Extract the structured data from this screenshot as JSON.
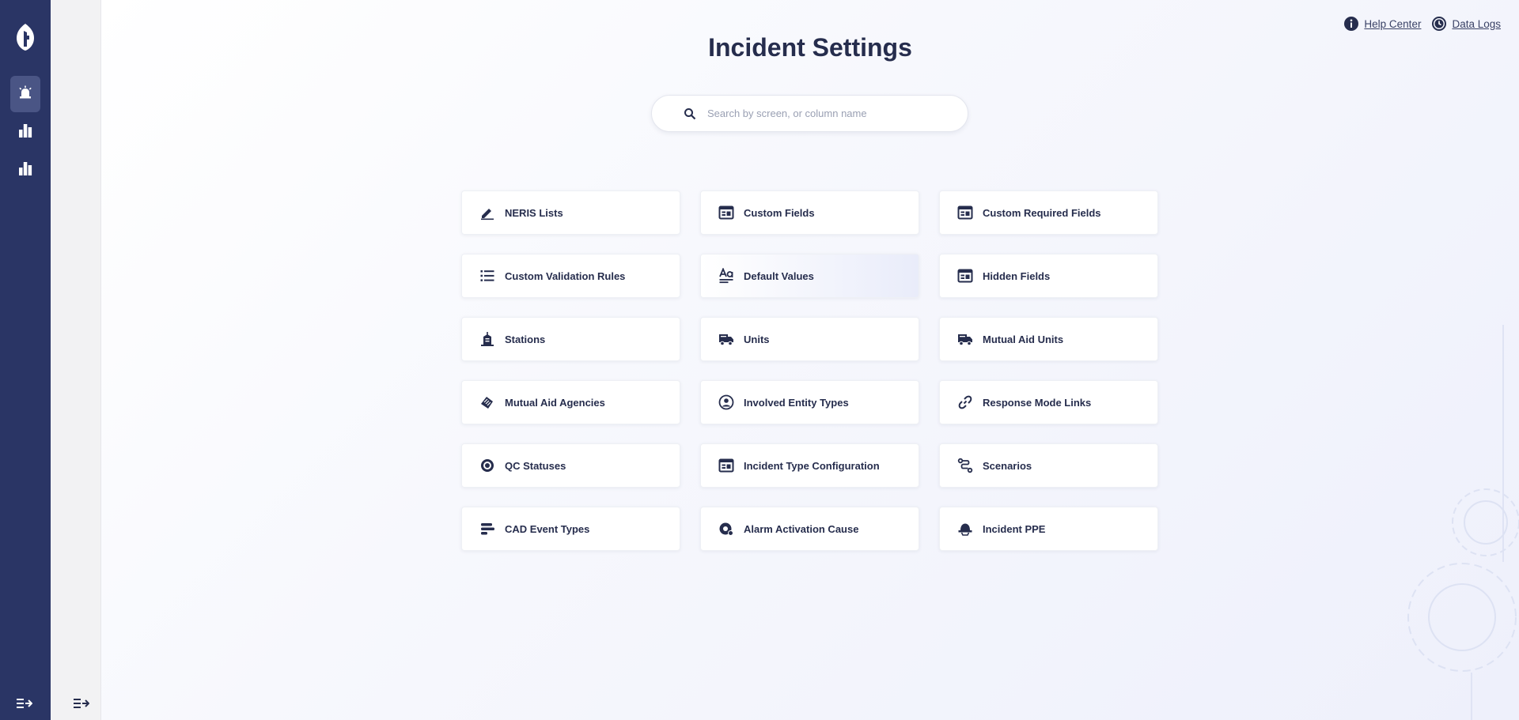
{
  "page": {
    "title": "Incident Settings"
  },
  "top_links": [
    {
      "label": "Help Center",
      "icon": "info-icon"
    },
    {
      "label": "Data Logs",
      "icon": "history-icon"
    }
  ],
  "search": {
    "placeholder": "Search by screen, or column name",
    "value": ""
  },
  "rail": {
    "items": [
      {
        "icon": "siren-icon",
        "active": true
      },
      {
        "icon": "bar-chart-icon",
        "active": false
      },
      {
        "icon": "bar-chart-icon",
        "active": false
      }
    ]
  },
  "cards": [
    {
      "label": "NERIS Lists",
      "icon": "pen-icon"
    },
    {
      "label": "Custom Fields",
      "icon": "table-form-icon"
    },
    {
      "label": "Custom Required Fields",
      "icon": "table-form-icon"
    },
    {
      "label": "Custom Validation Rules",
      "icon": "list-icon"
    },
    {
      "label": "Default Values",
      "icon": "text-format-icon"
    },
    {
      "label": "Hidden Fields",
      "icon": "table-form-icon"
    },
    {
      "label": "Stations",
      "icon": "station-icon"
    },
    {
      "label": "Units",
      "icon": "truck-icon"
    },
    {
      "label": "Mutual Aid Units",
      "icon": "truck-icon"
    },
    {
      "label": "Mutual Aid Agencies",
      "icon": "handshake-icon"
    },
    {
      "label": "Involved Entity Types",
      "icon": "person-circle-icon"
    },
    {
      "label": "Response Mode Links",
      "icon": "link-icon"
    },
    {
      "label": "QC Statuses",
      "icon": "target-icon"
    },
    {
      "label": "Incident Type Configuration",
      "icon": "table-form-icon"
    },
    {
      "label": "Scenarios",
      "icon": "route-icon"
    },
    {
      "label": "CAD Event Types",
      "icon": "stacked-bars-icon"
    },
    {
      "label": "Alarm Activation Cause",
      "icon": "alarm-icon"
    },
    {
      "label": "Incident PPE",
      "icon": "helmet-icon"
    }
  ],
  "colors": {
    "rail": "#2a3565",
    "rail_active": "#4a5585",
    "text": "#262d4d",
    "subrail": "#f2f2f3"
  }
}
